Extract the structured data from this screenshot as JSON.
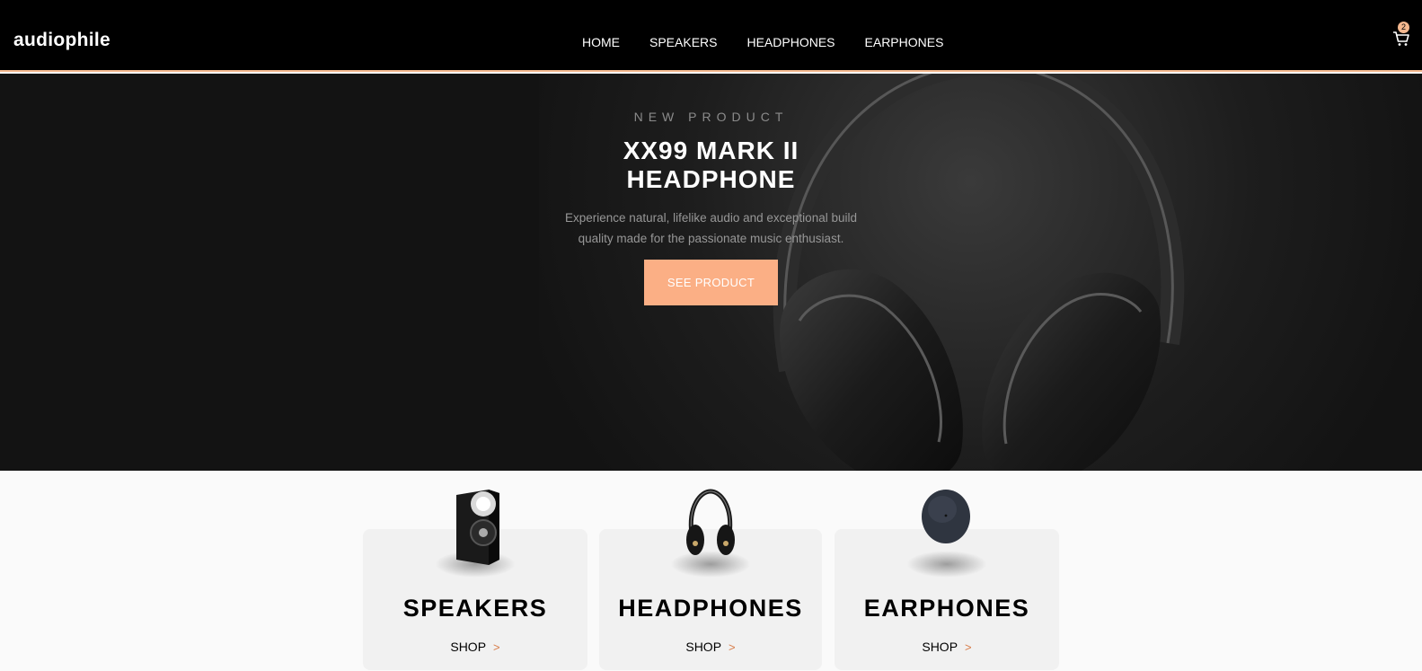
{
  "header": {
    "logo": "audiophile",
    "nav": [
      "HOME",
      "SPEAKERS",
      "HEADPHONES",
      "EARPHONES"
    ],
    "cart_count": "2",
    "cart_icon": "cart-icon"
  },
  "hero": {
    "overline": "NEW PRODUCT",
    "title_line1": "XX99 MARK II",
    "title_line2": "HEADPHONE",
    "description_line1": "Experience natural, lifelike audio and exceptional build",
    "description_line2": "quality made for the passionate music enthusiast.",
    "button": "SEE PRODUCT"
  },
  "categories": [
    {
      "title": "SPEAKERS",
      "link": "SHOP",
      "arrow": ">",
      "icon": "speaker-image"
    },
    {
      "title": "HEADPHONES",
      "link": "SHOP",
      "arrow": ">",
      "icon": "headphones-image"
    },
    {
      "title": "EARPHONES",
      "link": "SHOP",
      "arrow": ">",
      "icon": "earphones-case-image"
    }
  ],
  "colors": {
    "accent": "#fbaf85",
    "accent_dark": "#d87d4a",
    "header_bg": "#000000",
    "hero_bg": "#131313",
    "card_bg": "#f1f1f1"
  }
}
